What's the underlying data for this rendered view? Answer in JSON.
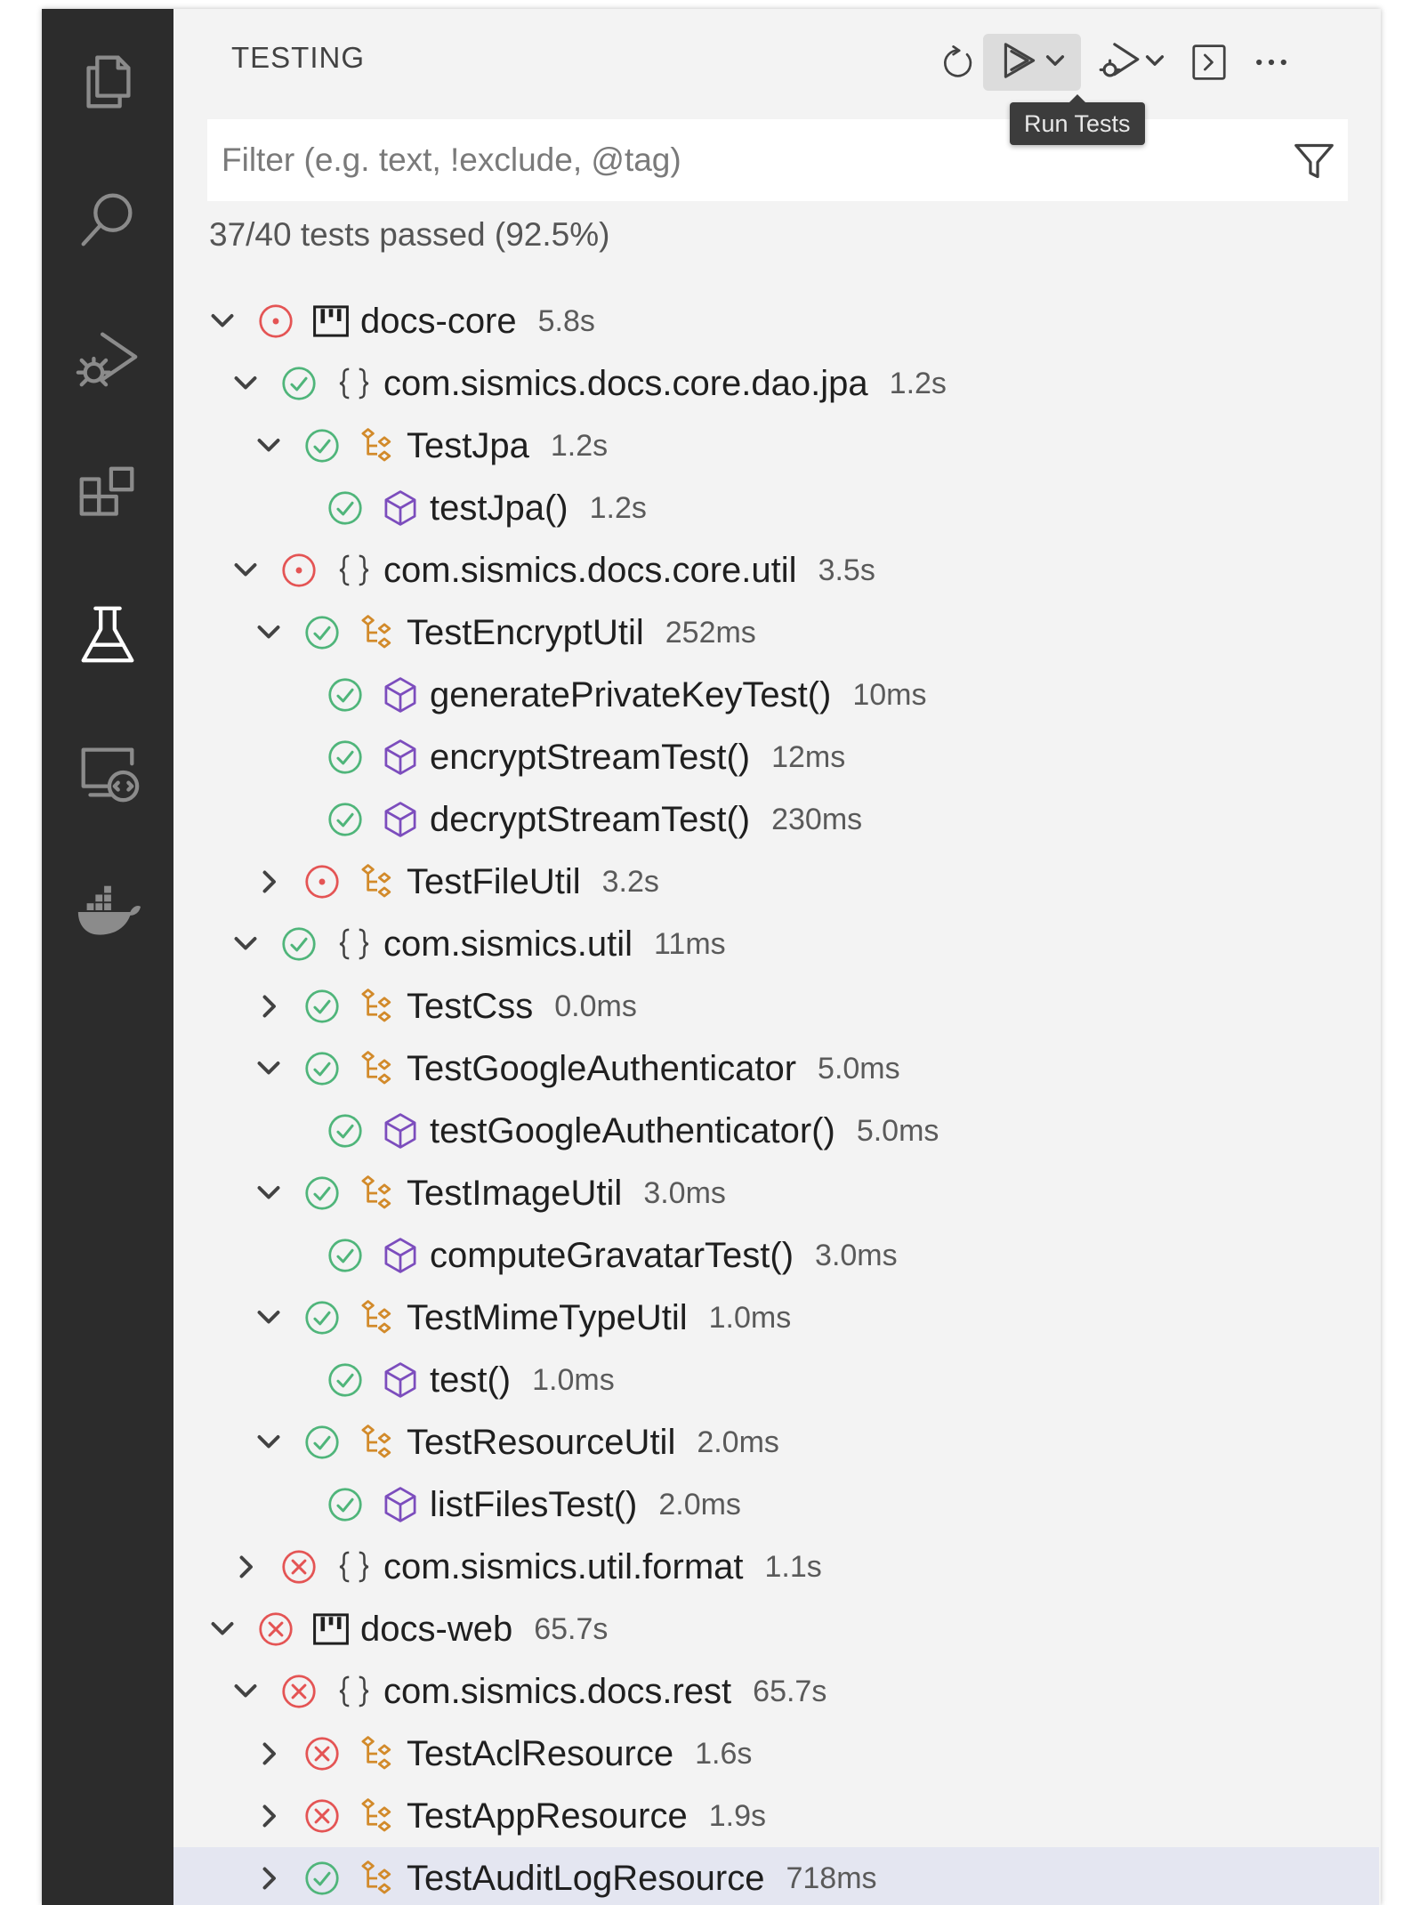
{
  "activity_bar": {
    "items": [
      {
        "name": "explorer-icon",
        "active": false
      },
      {
        "name": "search-icon",
        "active": false
      },
      {
        "name": "run-debug-icon",
        "active": false
      },
      {
        "name": "extensions-icon",
        "active": false
      },
      {
        "name": "testing-flask-icon",
        "active": true
      },
      {
        "name": "remote-explorer-icon",
        "active": false
      },
      {
        "name": "docker-icon",
        "active": false
      }
    ]
  },
  "panel": {
    "title": "TESTING",
    "toolbar": {
      "refresh": "refresh-icon",
      "run": "run-tests-icon",
      "debug": "debug-tests-icon",
      "terminal": "show-output-icon",
      "more": "more-actions-icon"
    },
    "tooltip": "Run Tests",
    "filter_placeholder": "Filter (e.g. text, !exclude, @tag)",
    "summary": "37/40 tests passed (92.5%)"
  },
  "colors": {
    "pass": "#4fb57a",
    "fail": "#e45454",
    "class_icon": "#d28a2a",
    "method_icon": "#7c4dbd",
    "selected_row": "#e4e6f1"
  },
  "tree": [
    {
      "level": 0,
      "twisty": "expanded",
      "status": "errored",
      "kind": "project",
      "label": "docs-core",
      "duration": "5.8s"
    },
    {
      "level": 1,
      "twisty": "expanded",
      "status": "passed",
      "kind": "package",
      "label": "com.sismics.docs.core.dao.jpa",
      "duration": "1.2s"
    },
    {
      "level": 2,
      "twisty": "expanded",
      "status": "passed",
      "kind": "class",
      "label": "TestJpa",
      "duration": "1.2s"
    },
    {
      "level": 3,
      "twisty": "none",
      "status": "passed",
      "kind": "method",
      "label": "testJpa()",
      "duration": "1.2s"
    },
    {
      "level": 1,
      "twisty": "expanded",
      "status": "errored",
      "kind": "package",
      "label": "com.sismics.docs.core.util",
      "duration": "3.5s"
    },
    {
      "level": 2,
      "twisty": "expanded",
      "status": "passed",
      "kind": "class",
      "label": "TestEncryptUtil",
      "duration": "252ms"
    },
    {
      "level": 3,
      "twisty": "none",
      "status": "passed",
      "kind": "method",
      "label": "generatePrivateKeyTest()",
      "duration": "10ms"
    },
    {
      "level": 3,
      "twisty": "none",
      "status": "passed",
      "kind": "method",
      "label": "encryptStreamTest()",
      "duration": "12ms"
    },
    {
      "level": 3,
      "twisty": "none",
      "status": "passed",
      "kind": "method",
      "label": "decryptStreamTest()",
      "duration": "230ms"
    },
    {
      "level": 2,
      "twisty": "collapsed",
      "status": "errored",
      "kind": "class",
      "label": "TestFileUtil",
      "duration": "3.2s"
    },
    {
      "level": 1,
      "twisty": "expanded",
      "status": "passed",
      "kind": "package",
      "label": "com.sismics.util",
      "duration": "11ms"
    },
    {
      "level": 2,
      "twisty": "collapsed",
      "status": "passed",
      "kind": "class",
      "label": "TestCss",
      "duration": "0.0ms"
    },
    {
      "level": 2,
      "twisty": "expanded",
      "status": "passed",
      "kind": "class",
      "label": "TestGoogleAuthenticator",
      "duration": "5.0ms"
    },
    {
      "level": 3,
      "twisty": "none",
      "status": "passed",
      "kind": "method",
      "label": "testGoogleAuthenticator()",
      "duration": "5.0ms"
    },
    {
      "level": 2,
      "twisty": "expanded",
      "status": "passed",
      "kind": "class",
      "label": "TestImageUtil",
      "duration": "3.0ms"
    },
    {
      "level": 3,
      "twisty": "none",
      "status": "passed",
      "kind": "method",
      "label": "computeGravatarTest()",
      "duration": "3.0ms"
    },
    {
      "level": 2,
      "twisty": "expanded",
      "status": "passed",
      "kind": "class",
      "label": "TestMimeTypeUtil",
      "duration": "1.0ms"
    },
    {
      "level": 3,
      "twisty": "none",
      "status": "passed",
      "kind": "method",
      "label": "test()",
      "duration": "1.0ms"
    },
    {
      "level": 2,
      "twisty": "expanded",
      "status": "passed",
      "kind": "class",
      "label": "TestResourceUtil",
      "duration": "2.0ms"
    },
    {
      "level": 3,
      "twisty": "none",
      "status": "passed",
      "kind": "method",
      "label": "listFilesTest()",
      "duration": "2.0ms"
    },
    {
      "level": 1,
      "twisty": "collapsed",
      "status": "failed",
      "kind": "package",
      "label": "com.sismics.util.format",
      "duration": "1.1s"
    },
    {
      "level": 0,
      "twisty": "expanded",
      "status": "failed",
      "kind": "project",
      "label": "docs-web",
      "duration": "65.7s"
    },
    {
      "level": 1,
      "twisty": "expanded",
      "status": "failed",
      "kind": "package",
      "label": "com.sismics.docs.rest",
      "duration": "65.7s"
    },
    {
      "level": 2,
      "twisty": "collapsed",
      "status": "failed",
      "kind": "class",
      "label": "TestAclResource",
      "duration": "1.6s"
    },
    {
      "level": 2,
      "twisty": "collapsed",
      "status": "failed",
      "kind": "class",
      "label": "TestAppResource",
      "duration": "1.9s"
    },
    {
      "level": 2,
      "twisty": "collapsed",
      "status": "passed",
      "kind": "class",
      "label": "TestAuditLogResource",
      "duration": "718ms",
      "selected": true
    }
  ]
}
